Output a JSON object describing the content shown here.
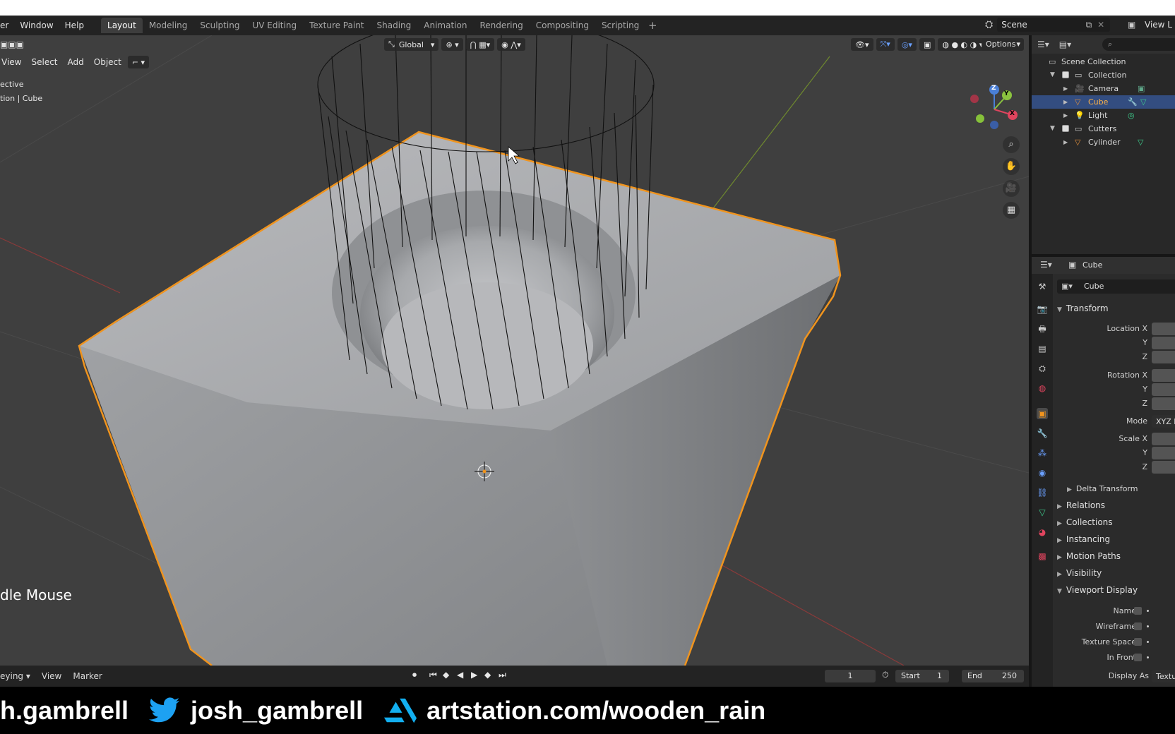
{
  "topbar": {
    "menus": [
      "er",
      "Window",
      "Help"
    ],
    "workspaces": [
      "Layout",
      "Modeling",
      "Sculpting",
      "UV Editing",
      "Texture Paint",
      "Shading",
      "Animation",
      "Rendering",
      "Compositing",
      "Scripting"
    ],
    "active_workspace": "Layout",
    "add_symbol": "+",
    "scene": "Scene",
    "view_layer": "View L"
  },
  "viewport": {
    "menus": [
      "View",
      "Select",
      "Add",
      "Object"
    ],
    "orientation": "Global",
    "options_label": "Options",
    "info_line1": "ective",
    "info_line2": "tion | Cube",
    "hint": "dle Mouse",
    "gizmo": {
      "x": "X",
      "y": "Y",
      "z": "Z"
    }
  },
  "timeline": {
    "menus": [
      "eying",
      "View",
      "Marker"
    ],
    "current_frame": "1",
    "start_label": "Start",
    "start_value": "1",
    "end_label": "End",
    "end_value": "250"
  },
  "outliner": {
    "rows": [
      {
        "label": "Scene Collection"
      },
      {
        "label": "Collection"
      },
      {
        "label": "Camera"
      },
      {
        "label": "Cube"
      },
      {
        "label": "Light"
      },
      {
        "label": "Cutters"
      },
      {
        "label": "Cylinder"
      }
    ]
  },
  "properties": {
    "header_object": "Cube",
    "object_name": "Cube",
    "transform_label": "Transform",
    "location_x": "Location X",
    "y": "Y",
    "z": "Z",
    "rotation_x": "Rotation X",
    "mode_label": "Mode",
    "mode_value": "XYZ E",
    "scale_x": "Scale X",
    "delta_transform": "Delta Transform",
    "panels": [
      "Relations",
      "Collections",
      "Instancing",
      "Motion Paths",
      "Visibility"
    ],
    "viewport_display": "Viewport Display",
    "vd_rows": [
      "Name",
      "Wireframe",
      "Texture Space",
      "In Front"
    ],
    "display_as_label": "Display As",
    "display_as_value": "Textu"
  },
  "banner": {
    "handle1": "h.gambrell",
    "handle2": "josh_gambrell",
    "site": "artstation.com/wooden_rain"
  },
  "colors": {
    "selection_outline": "#f0941e",
    "accent_blue": "#4772b3",
    "twitter": "#1da1f2",
    "artstation": "#13aff0"
  }
}
